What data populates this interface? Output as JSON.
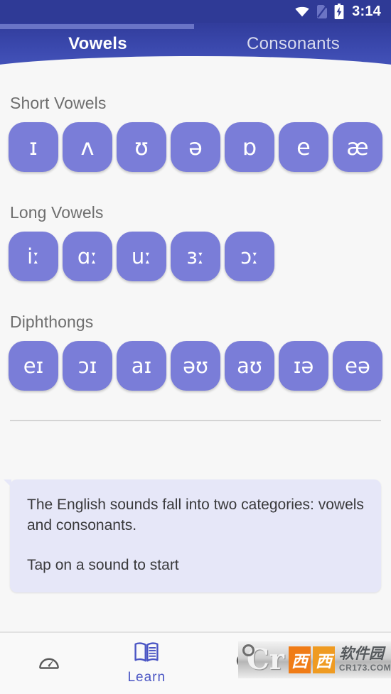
{
  "statusbar": {
    "time": "3:14",
    "icons": [
      "wifi-icon",
      "sim-card-icon",
      "battery-charging-icon"
    ]
  },
  "header": {
    "progress_percent": 50,
    "tabs": [
      {
        "label": "Vowels",
        "active": true
      },
      {
        "label": "Consonants",
        "active": false
      }
    ]
  },
  "sections": [
    {
      "title": "Short Vowels",
      "sounds": [
        "ɪ",
        "ʌ",
        "ʊ",
        "ə",
        "ɒ",
        "e",
        "æ"
      ]
    },
    {
      "title": "Long Vowels",
      "sounds": [
        "iː",
        "ɑː",
        "uː",
        "ɜː",
        "ɔː"
      ]
    },
    {
      "title": "Diphthongs",
      "sounds": [
        "eɪ",
        "ɔɪ",
        "aɪ",
        "əʊ",
        "aʊ",
        "ɪə",
        "eə"
      ]
    }
  ],
  "info_bubble": {
    "paragraph1": "The English sounds fall into two categories: vowels and consonants.",
    "paragraph2": "Tap on a sound to start"
  },
  "bottom_nav": [
    {
      "icon": "speedometer-icon",
      "label": "",
      "active": false
    },
    {
      "icon": "open-book-icon",
      "label": "Learn",
      "active": true
    },
    {
      "icon": "search-icon",
      "label": "",
      "active": false
    },
    {
      "icon": "account-icon",
      "label": "",
      "active": false
    }
  ],
  "watermark": {
    "logo": "Cr",
    "badge1": "西",
    "badge2": "西",
    "name": "软件园",
    "url": "CR173.COM"
  },
  "colors": {
    "status_bar": "#2f3a96",
    "header_gradient_top": "#313c9b",
    "header_gradient_bottom": "#4554bb",
    "tile": "#7a7dd8",
    "page_bg": "#f7f7f7",
    "bubble_bg": "#e6e7f8",
    "accent": "#4a55c4",
    "section_title": "#6e6e6e"
  }
}
